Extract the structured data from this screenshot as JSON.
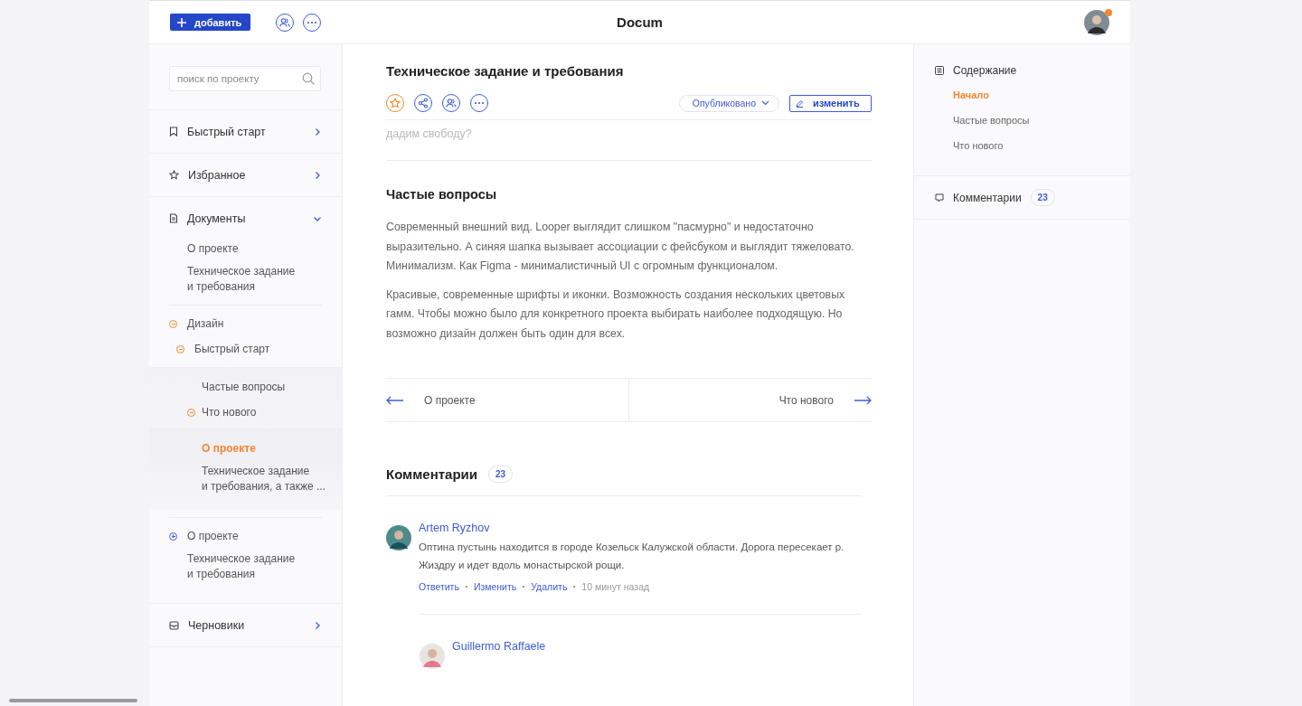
{
  "header": {
    "add_button": "добавить",
    "title": "Docum",
    "avatar": {
      "notification": true
    }
  },
  "sidebar": {
    "search": {
      "placeholder": "поиск по проекту"
    },
    "sections": [
      {
        "label": "Быстрый старт",
        "expanded": false
      },
      {
        "label": "Избранное",
        "expanded": false
      },
      {
        "label": "Документы",
        "expanded": true,
        "groups": [
          [
            {
              "label": "О проекте",
              "selected": false
            },
            {
              "label": "Техническое задание\nи требования",
              "selected": false
            }
          ],
          [
            {
              "label": "Дизайн",
              "selected": false,
              "expanded": true,
              "children": [
                {
                  "label": "Быстрый старт",
                  "selected": false,
                  "expanded": true,
                  "children": [
                    {
                      "label": "Частые вопросы",
                      "selected": false
                    },
                    {
                      "label": "Что нового",
                      "selected": false,
                      "expanded": true,
                      "children": [
                        {
                          "label": "О проекте",
                          "selected": true
                        },
                        {
                          "label": "Техническое задание\nи требования, а также ...",
                          "selected": false
                        }
                      ]
                    }
                  ]
                }
              ]
            }
          ],
          [
            {
              "label": "О проекте",
              "selected": false,
              "expanded": false
            },
            {
              "label": "Техническое задание\nи требования",
              "selected": false
            }
          ]
        ]
      },
      {
        "label": "Черновики",
        "expanded": false
      }
    ]
  },
  "document": {
    "title": "Техническое задание и требования",
    "starred": true,
    "status": "Опубликовано",
    "edit_button": "изменить",
    "faded_text": "дадим свободу?",
    "section_title": "Частые вопросы",
    "paragraphs": [
      "Современный внешний вид. Looper выглядит слишком \"пасмурно\" и недостаточно выразительно. А синяя шапка вызывает ассоциации с фейсбуком и выглядит тяжеловато. Минимализм. Как Figma - минималистичный UI с огромным функционалом.",
      "Красивые, современные шрифты и иконки. Возможность создания нескольких цветовых гамм. Чтобы можно было для конкретного проекта выбирать наиболее подходящую. Но возможно дизайн должен быть один для всех."
    ],
    "prev": "О проекте",
    "next": "Что нового"
  },
  "comments": {
    "title": "Комментарии",
    "count": "23",
    "items": [
      {
        "author": "Artem Ryzhov",
        "text": "Оптина пустынь находится в городе Козельск Калужской области. Дорога пересекает р. Жиздру и идет вдоль  монастырской рощи.",
        "actions": [
          "Ответить",
          "Изменить",
          "Удалить"
        ],
        "time": "10 минут назад",
        "replies": [
          {
            "author": "Guillermo Raffaele"
          }
        ]
      }
    ]
  },
  "contents": {
    "title": "Содержание",
    "items": [
      {
        "label": "Начало",
        "selected": true
      },
      {
        "label": "Частые вопросы",
        "selected": false
      },
      {
        "label": "Что нового",
        "selected": false
      }
    ],
    "comments_label": "Комментарии",
    "comments_count": "23"
  }
}
